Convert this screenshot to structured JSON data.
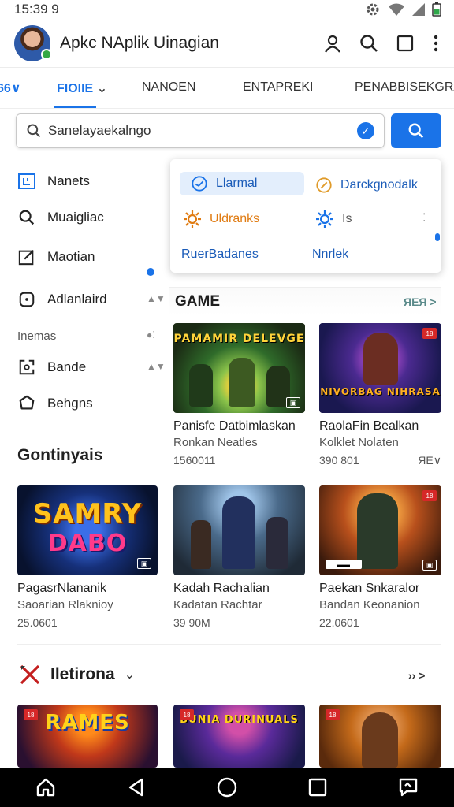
{
  "status": {
    "time": "15:39 9"
  },
  "header": {
    "title": "Apkc NAplik Uinagian"
  },
  "tabs": [
    {
      "label": "66∨"
    },
    {
      "label": "FIOIIE"
    },
    {
      "label": "NANOEN"
    },
    {
      "label": "ENTAPREKI"
    },
    {
      "label": "PENABBISEKGRA"
    }
  ],
  "search": {
    "placeholder": "Sanelayaekalngo"
  },
  "sidebar": {
    "items": [
      {
        "label": "Nanets",
        "icon": "layout-icon"
      },
      {
        "label": "Muaigliac",
        "icon": "search-icon"
      },
      {
        "label": "Maotian",
        "icon": "edit-icon"
      },
      {
        "label": "Adlanlaird",
        "icon": "circle-dot-icon"
      }
    ],
    "section_label": "Inemas",
    "items2": [
      {
        "label": "Bande",
        "icon": "square-c-icon"
      },
      {
        "label": "Behgns",
        "icon": "hexagon-icon"
      }
    ],
    "continue_label": "Gontinyais"
  },
  "dropdown": {
    "items": [
      {
        "label": "Llarmal"
      },
      {
        "label": "Darckgnodalk"
      },
      {
        "label": "Uldranks"
      },
      {
        "label": "Is"
      },
      {
        "label": "RuerBadanes"
      },
      {
        "label": "Nnrlek"
      }
    ]
  },
  "section_game": {
    "title": "GAME",
    "more": "ЯEЯ >"
  },
  "games": [
    {
      "art": "PAMAMIR DELEVGE",
      "title": "Panisfe Datbimlaskan",
      "sub": "Ronkan Neatles",
      "meta": "1560011"
    },
    {
      "art": "NIVORBAG NIHRASA",
      "title": "RaolaFin Bealkan",
      "sub": "Kolklet Nolaten",
      "meta": "390 801",
      "extra": "ЯE∨"
    }
  ],
  "continue_games": [
    {
      "art1": "SAMRY",
      "art2": "DABO",
      "title": "PagasrNlananik",
      "sub": "Saoarian Rlaknioy",
      "meta": "25.0601"
    },
    {
      "title": "Kadah Rachalian",
      "sub": "Kadatan Rachtar",
      "meta": "39 90M"
    },
    {
      "title": "Paekan Snkaralor",
      "sub": "Bandan Keonanion",
      "meta": "22.0601"
    }
  ],
  "section_recent": {
    "title": "Iletirona",
    "more": "›› >"
  },
  "recent_games": [
    {
      "art": "RAMES"
    },
    {
      "art": "BUNIA DURINUALS"
    },
    {
      "art": ""
    }
  ],
  "colors": {
    "accent": "#1a73e8",
    "orange": "#e07b12",
    "nav": "#000000"
  }
}
